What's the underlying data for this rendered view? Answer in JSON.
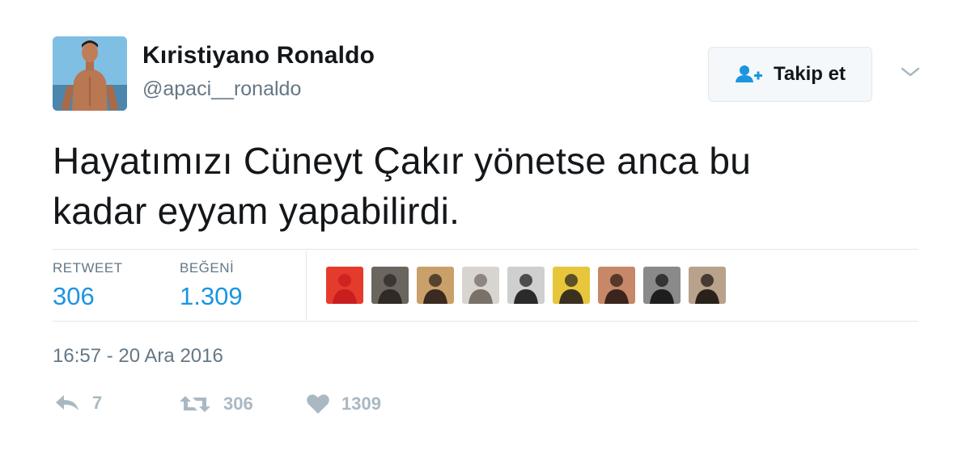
{
  "user": {
    "display_name": "Kıristiyano Ronaldo",
    "handle": "@apaci__ronaldo"
  },
  "follow_button": {
    "label": "Takip et",
    "icon": "follow-person-plus-icon"
  },
  "tweet": {
    "text_line1": "Hayatımızı Cüneyt Çakır yönetse anca bu",
    "text_line2": "kadar eyyam yapabilirdi."
  },
  "stats": {
    "retweet_label": "RETWEET",
    "retweet_value": "306",
    "likes_label": "BEĞENİ",
    "likes_value": "1.309"
  },
  "likers": [
    {
      "name": "liker-avatar-1",
      "colors": [
        "#e53b2c",
        "#c81e1e"
      ]
    },
    {
      "name": "liker-avatar-2",
      "colors": [
        "#6b6560",
        "#2f2a26"
      ]
    },
    {
      "name": "liker-avatar-3",
      "colors": [
        "#caa06a",
        "#3a2a20"
      ]
    },
    {
      "name": "liker-avatar-4",
      "colors": [
        "#d8d4cf",
        "#7a716a"
      ]
    },
    {
      "name": "liker-avatar-5",
      "colors": [
        "#cfcfcf",
        "#2a2a2a"
      ]
    },
    {
      "name": "liker-avatar-6",
      "colors": [
        "#e7c63c",
        "#3a3020"
      ]
    },
    {
      "name": "liker-avatar-7",
      "colors": [
        "#c68868",
        "#3b241b"
      ]
    },
    {
      "name": "liker-avatar-8",
      "colors": [
        "#8a8a8a",
        "#1e1e1e"
      ]
    },
    {
      "name": "liker-avatar-9",
      "colors": [
        "#b8a28c",
        "#2b211b"
      ]
    }
  ],
  "timestamp": "16:57 - 20 Ara 2016",
  "actions": {
    "reply_count": "7",
    "retweet_count": "306",
    "like_count": "1309"
  },
  "colors": {
    "accent": "#1b95e0",
    "muted": "#657786",
    "icon_muted": "#aab8c2",
    "divider": "#e1e8ed"
  }
}
